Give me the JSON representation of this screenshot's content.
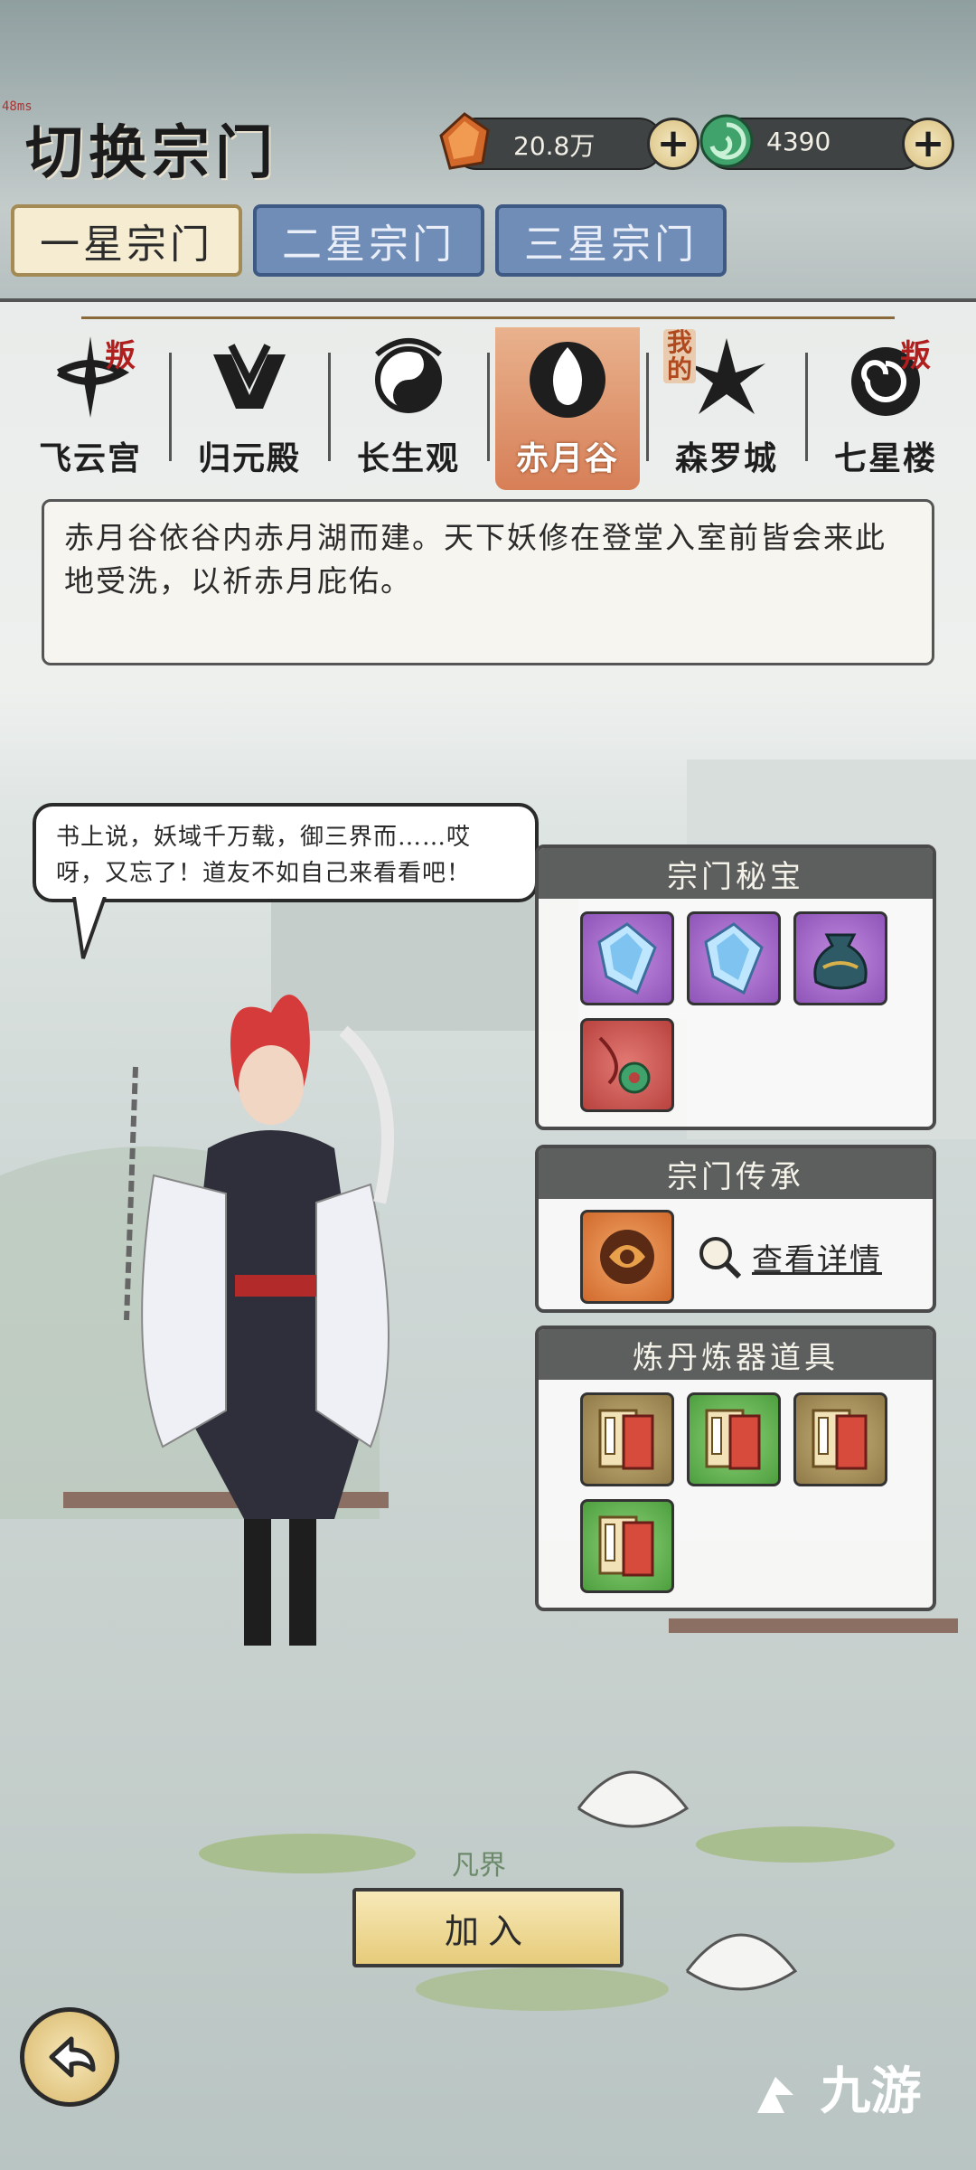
{
  "header": {
    "title": "切换宗门",
    "fps": "48ms",
    "currencies": [
      {
        "icon": "amber-crystal-icon",
        "value": "20.8万"
      },
      {
        "icon": "jade-swirl-icon",
        "value": "4390"
      }
    ],
    "plus_label": "+"
  },
  "tabs": [
    {
      "label": "一星宗门",
      "active": true
    },
    {
      "label": "二星宗门",
      "active": false
    },
    {
      "label": "三星宗门",
      "active": false
    }
  ],
  "sects": [
    {
      "name": "飞云宫",
      "badge": "叛",
      "selected": false
    },
    {
      "name": "归元殿",
      "badge": "",
      "selected": false
    },
    {
      "name": "长生观",
      "badge": "",
      "selected": false
    },
    {
      "name": "赤月谷",
      "badge": "",
      "selected": true
    },
    {
      "name": "森罗城",
      "badge": "我的",
      "selected": false
    },
    {
      "name": "七星楼",
      "badge": "叛",
      "selected": false
    }
  ],
  "description": "赤月谷依谷内赤月湖而建。天下妖修在登堂入室前皆会来此地受洗，以祈赤月庇佑。",
  "speech": "书上说，妖域千万载，御三界而……哎呀，又忘了！道友不如自己来看看吧！",
  "panels": {
    "treasure": {
      "title": "宗门秘宝",
      "items": [
        {
          "icon": "blue-crystal-icon",
          "color": "purple"
        },
        {
          "icon": "blue-crystal-icon",
          "color": "purple"
        },
        {
          "icon": "treasure-pouch-icon",
          "color": "purple"
        },
        {
          "icon": "jade-pendant-icon",
          "color": "red"
        }
      ]
    },
    "inheritance": {
      "title": "宗门传承",
      "item": {
        "icon": "beast-emblem-icon",
        "color": "orange"
      },
      "details_label": "查看详情"
    },
    "tools": {
      "title": "炼丹炼器道具",
      "items": [
        {
          "icon": "manual-book-icon",
          "color": "olive"
        },
        {
          "icon": "manual-book-icon",
          "color": "green"
        },
        {
          "icon": "manual-book-icon",
          "color": "olive"
        },
        {
          "icon": "manual-book-icon",
          "color": "green"
        }
      ]
    }
  },
  "realm_label": "凡界",
  "join_label": "加入",
  "watermark": "九游"
}
